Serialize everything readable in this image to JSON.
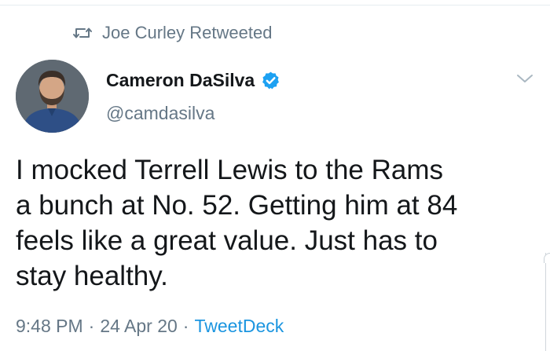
{
  "retweet": {
    "icon": "retweet-icon",
    "label": "Joe Curley Retweeted"
  },
  "author": {
    "display_name": "Cameron DaSilva",
    "handle": "@camdasilva",
    "verified_icon": "verified-badge-icon",
    "avatar_icon": "avatar-silhouette-icon"
  },
  "menu": {
    "icon": "chevron-down-icon"
  },
  "tweet": {
    "lines": [
      "I mocked Terrell Lewis to the Rams",
      "a bunch at No. 52. Getting him at 84",
      "feels like a great value. Just has to",
      "stay healthy."
    ]
  },
  "meta": {
    "time": "9:48 PM",
    "separator": "·",
    "date": "24 Apr 20",
    "source": "TweetDeck"
  },
  "colors": {
    "text": "#14171a",
    "secondary": "#657786",
    "accent": "#1b95e0"
  }
}
